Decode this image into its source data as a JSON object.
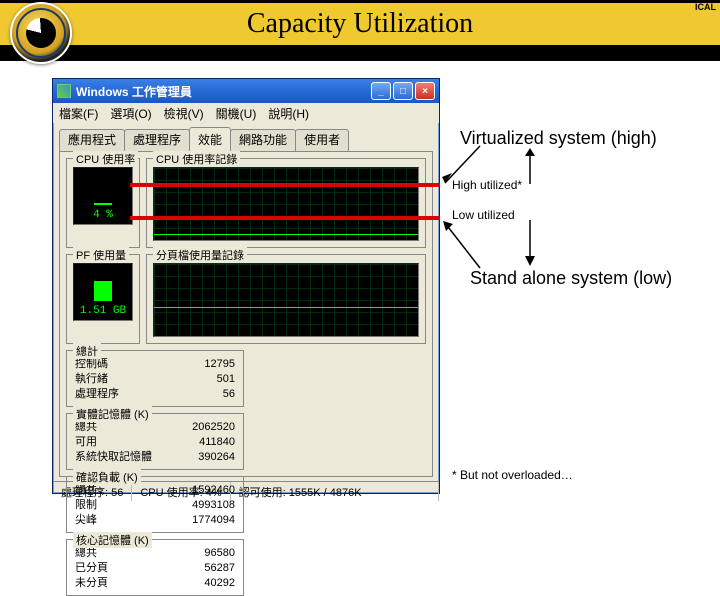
{
  "corner_tag": "ICAL",
  "header": {
    "title": "Capacity Utilization"
  },
  "window": {
    "title": "Windows 工作管理員",
    "menu": [
      "檔案(F)",
      "選項(O)",
      "檢視(V)",
      "關機(U)",
      "說明(H)"
    ],
    "tabs": [
      "應用程式",
      "處理程序",
      "效能",
      "網路功能",
      "使用者"
    ],
    "active_tab_index": 2,
    "cpu": {
      "label": "CPU 使用率",
      "value": "4 %",
      "bar_pct": 4
    },
    "cpu_hist": {
      "label": "CPU 使用率記錄"
    },
    "pf": {
      "label": "PF 使用量",
      "value": "1.51 GB",
      "bar_pct": 38
    },
    "pf_hist": {
      "label": "分頁檔使用量記錄"
    },
    "stats": {
      "totals": {
        "label": "總計",
        "rows": [
          [
            "控制碼",
            "12795"
          ],
          [
            "執行緒",
            "501"
          ],
          [
            "處理程序",
            "56"
          ]
        ]
      },
      "physmem": {
        "label": "實體記憶體 (K)",
        "rows": [
          [
            "總共",
            "2062520"
          ],
          [
            "可用",
            "411840"
          ],
          [
            "系統快取記憶體",
            "390264"
          ]
        ]
      },
      "commit": {
        "label": "確認負載 (K)",
        "rows": [
          [
            "總共",
            "1592460"
          ],
          [
            "限制",
            "4993108"
          ],
          [
            "尖峰",
            "1774094"
          ]
        ]
      },
      "kernel": {
        "label": "核心記憶體 (K)",
        "rows": [
          [
            "總共",
            "96580"
          ],
          [
            "已分頁",
            "56287"
          ],
          [
            "未分頁",
            "40292"
          ]
        ]
      }
    },
    "status": {
      "procs": "處理程序: 56",
      "cpu": "CPU 使用率: 4%",
      "commit": "認可使用: 1555K / 4876K"
    },
    "btn": {
      "min": "_",
      "max": "□",
      "close": "×"
    }
  },
  "annot": {
    "virt": "Virtualized system (high)",
    "high": "High utilized*",
    "low": "Low utilized",
    "stand": "Stand alone system (low)",
    "foot": "* But not overloaded…"
  }
}
